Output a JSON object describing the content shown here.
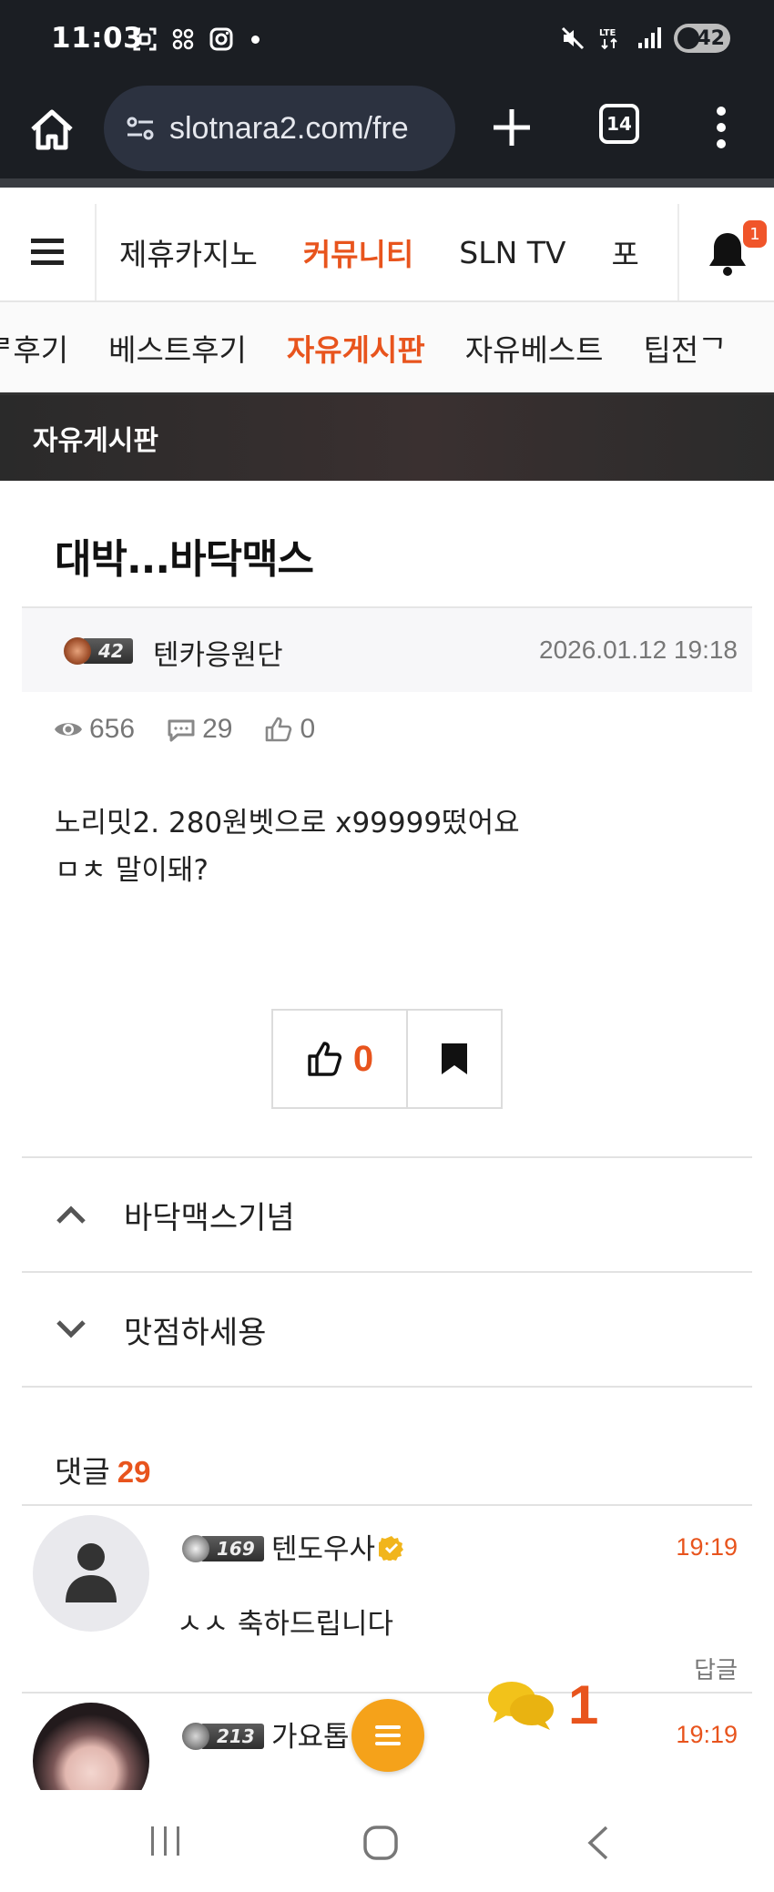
{
  "status_bar": {
    "time": "11:03",
    "battery": "42",
    "network": "LTE"
  },
  "browser": {
    "url": "slotnara2.com/fre",
    "tab_count": "14"
  },
  "site_nav": {
    "items": [
      "제휴카지노",
      "커뮤니티",
      "SLN TV",
      "포"
    ],
    "active_index": 1,
    "notification_count": "1"
  },
  "sub_nav": {
    "items": [
      "ᄅ후기",
      "베스트후기",
      "자유게시판",
      "자유베스트",
      "팁전ᄀ"
    ],
    "active_index": 2
  },
  "board": {
    "title": "자유게시판"
  },
  "post": {
    "title": "대박...바닥맥스",
    "author_level": "42",
    "author": "텐카응원단",
    "date": "2026.01.12 19:18",
    "views": "656",
    "comments": "29",
    "likes": "0",
    "body_lines": [
      "노리밋2. 280원벳으로 x99999떴어요",
      "ㅁㅊ 말이돼?"
    ],
    "like_button_count": "0"
  },
  "adjacent": {
    "prev_label": "바닥맥스기념",
    "next_label": "맛점하세용"
  },
  "comments": {
    "heading": "댓글",
    "count": "29",
    "items": [
      {
        "level": "169",
        "author": "텐도우사",
        "time": "19:19",
        "text": "ㅅㅅ 축하드립니다",
        "reply_label": "답글"
      },
      {
        "level": "213",
        "author": "가요톱",
        "time": "19:19"
      }
    ]
  },
  "floating": {
    "chat_count": "1"
  },
  "colors": {
    "accent": "#e8541d",
    "fab": "#f5a21a",
    "dark_bar": "#1b1e23"
  },
  "icons": [
    "home-icon",
    "site-settings-icon",
    "plus-icon",
    "tabs-icon",
    "more-icon",
    "menu-icon",
    "bell-icon",
    "eye-icon",
    "comment-icon",
    "thumb-up-icon",
    "bookmark-icon",
    "chevron-up-icon",
    "chevron-down-icon",
    "user-icon",
    "verified-icon",
    "chat-bubbles-icon"
  ]
}
